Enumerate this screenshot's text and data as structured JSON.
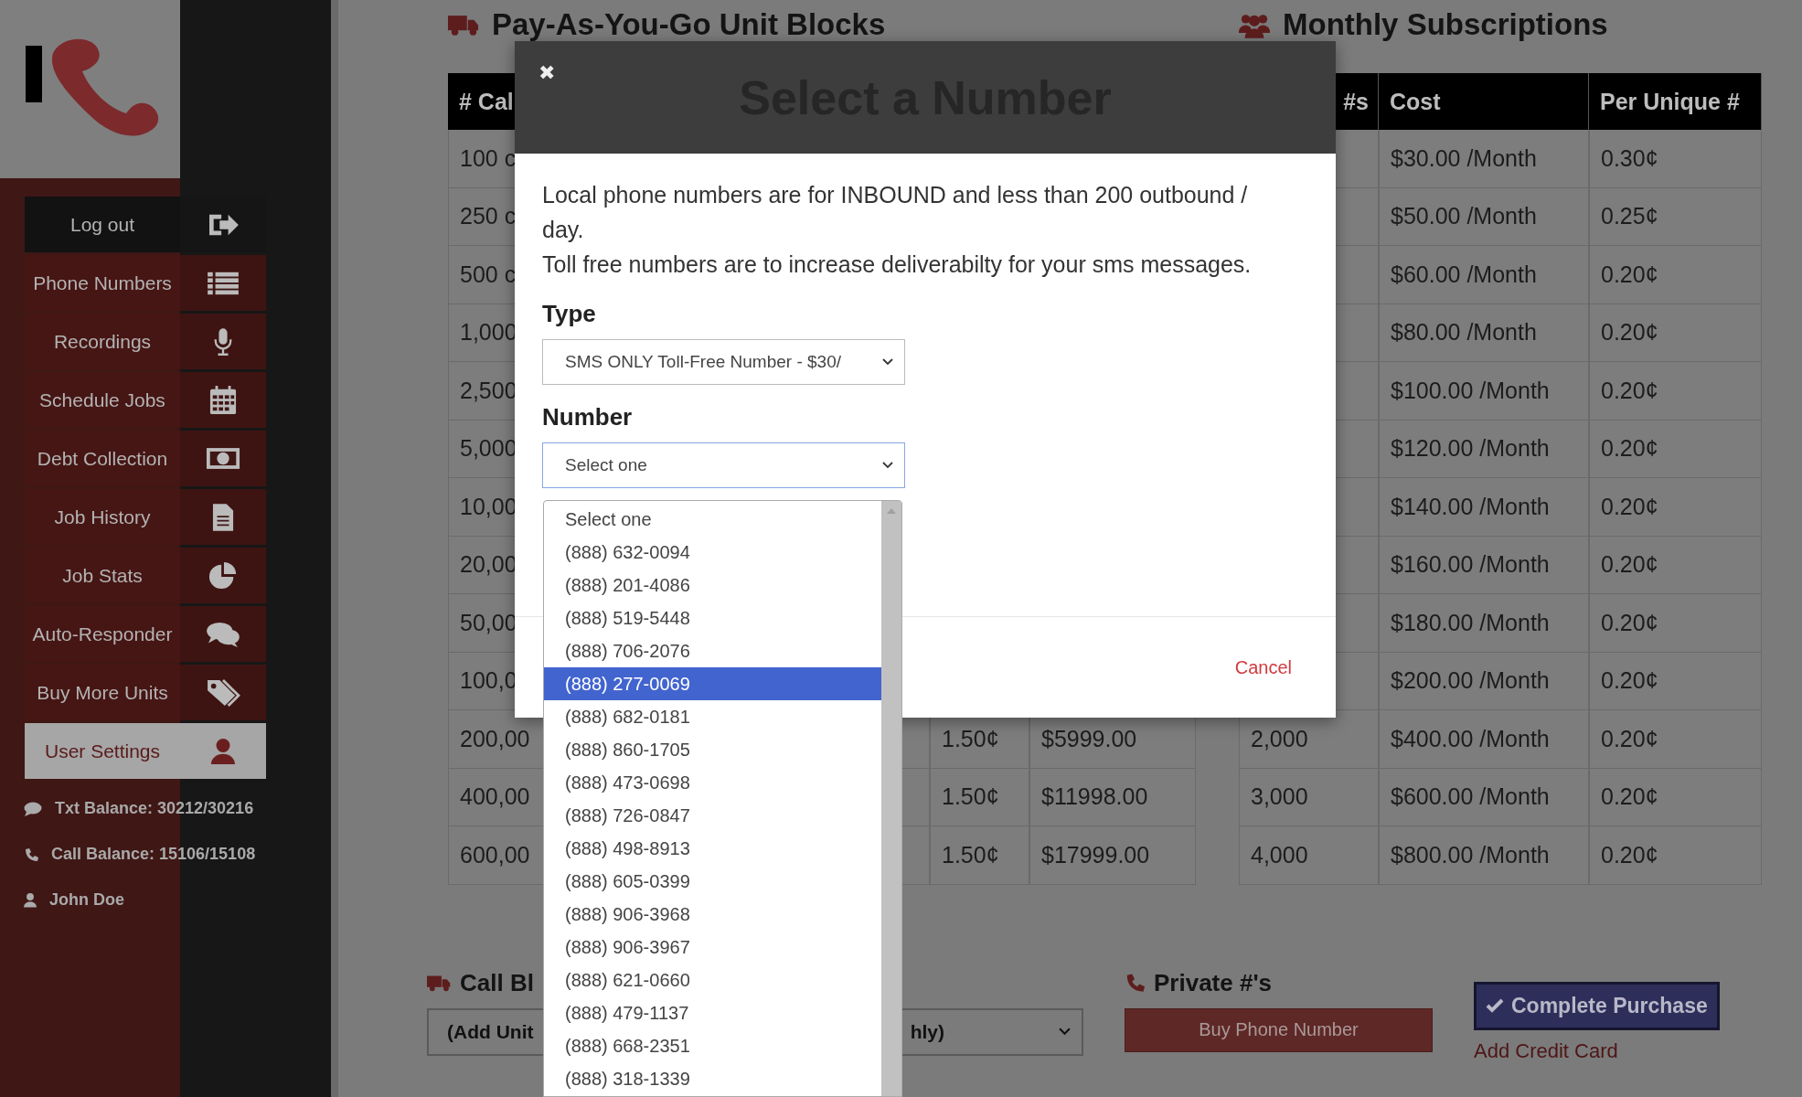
{
  "sidebar": {
    "logout": "Log out",
    "items": [
      {
        "label": "Phone Numbers",
        "selected": false
      },
      {
        "label": "Recordings",
        "selected": false
      },
      {
        "label": "Schedule Jobs",
        "selected": false
      },
      {
        "label": "Debt Collection",
        "selected": false
      },
      {
        "label": "Job History",
        "selected": false
      },
      {
        "label": "Job Stats",
        "selected": false
      },
      {
        "label": "Auto-Responder",
        "selected": false
      },
      {
        "label": "Buy More Units",
        "selected": false
      },
      {
        "label": "User Settings",
        "selected": true
      }
    ],
    "balances": [
      {
        "kind": "txt",
        "text": "Txt Balance: 30212/30216"
      },
      {
        "kind": "call",
        "text": "Call Balance: 15106/15108"
      },
      {
        "kind": "user",
        "text": "John Doe"
      }
    ]
  },
  "payg": {
    "title": "Pay-As-You-Go Unit Blocks",
    "columns": [
      "# Cal"
    ],
    "rows": [
      {
        "column_1": "100 c"
      },
      {
        "column_1": "250 c"
      },
      {
        "column_1": "500 c"
      },
      {
        "column_1": "1,000"
      },
      {
        "column_1": "2,500"
      },
      {
        "column_1": "5,000"
      },
      {
        "column_1": "10,00"
      },
      {
        "column_1": "20,00"
      },
      {
        "column_1": "50,00"
      },
      {
        "column_1": "100,0"
      },
      {
        "column_1": "200,00",
        "column_2": "1.50¢",
        "column_3": "$5999.00"
      },
      {
        "column_1": "400,00",
        "column_2": "1.50¢",
        "column_3": "$11998.00"
      },
      {
        "column_1": "600,00",
        "column_2": "1.50¢",
        "column_3": "$17999.00"
      }
    ]
  },
  "monthly": {
    "title": "Monthly Subscriptions",
    "columns": [
      "#s",
      "Cost",
      "Per Unique #"
    ],
    "rows": [
      {
        "cost": "$30.00 /Month",
        "per_unique": "0.30¢"
      },
      {
        "cost": "$50.00 /Month",
        "per_unique": "0.25¢"
      },
      {
        "cost": "$60.00 /Month",
        "per_unique": "0.20¢"
      },
      {
        "cost": "$80.00 /Month",
        "per_unique": "0.20¢"
      },
      {
        "cost": "$100.00 /Month",
        "per_unique": "0.20¢"
      },
      {
        "cost": "$120.00 /Month",
        "per_unique": "0.20¢"
      },
      {
        "cost": "$140.00 /Month",
        "per_unique": "0.20¢"
      },
      {
        "cost": "$160.00 /Month",
        "per_unique": "0.20¢"
      },
      {
        "cost": "$180.00 /Month",
        "per_unique": "0.20¢"
      },
      {
        "cost": "$200.00 /Month",
        "per_unique": "0.20¢"
      },
      {
        "column_1": "2,000",
        "cost": "$400.00 /Month",
        "per_unique": "0.20¢"
      },
      {
        "column_1": "3,000",
        "cost": "$600.00 /Month",
        "per_unique": "0.20¢"
      },
      {
        "column_1": "4,000",
        "cost": "$800.00 /Month",
        "per_unique": "0.20¢"
      }
    ]
  },
  "call_blocks": {
    "title": "Call Bl",
    "select_left": "(Add Unit",
    "select_right": "hly)"
  },
  "private": {
    "title": "Private #'s",
    "button": "Buy Phone Number"
  },
  "complete_purchase": "Complete Purchase",
  "add_credit_card": "Add Credit Card",
  "modal": {
    "title": "Select a Number",
    "close": "✖",
    "intro": [
      "Local phone numbers are for INBOUND and less than 200 outbound / day.",
      "Toll free numbers are to increase deliverabilty for your sms messages."
    ],
    "type_label": "Type",
    "type_value": "SMS ONLY Toll-Free Number - $30/",
    "number_label": "Number",
    "number_value": "Select one",
    "options": [
      {
        "label": "Select one",
        "selected": false
      },
      {
        "label": "(888) 632-0094",
        "selected": false
      },
      {
        "label": "(888) 201-4086",
        "selected": false
      },
      {
        "label": "(888) 519-5448",
        "selected": false
      },
      {
        "label": "(888) 706-2076",
        "selected": false
      },
      {
        "label": "(888) 277-0069",
        "selected": true
      },
      {
        "label": "(888) 682-0181",
        "selected": false
      },
      {
        "label": "(888) 860-1705",
        "selected": false
      },
      {
        "label": "(888) 473-0698",
        "selected": false
      },
      {
        "label": "(888) 726-0847",
        "selected": false
      },
      {
        "label": "(888) 498-8913",
        "selected": false
      },
      {
        "label": "(888) 605-0399",
        "selected": false
      },
      {
        "label": "(888) 906-3968",
        "selected": false
      },
      {
        "label": "(888) 906-3967",
        "selected": false
      },
      {
        "label": "(888) 621-0660",
        "selected": false
      },
      {
        "label": "(888) 479-1137",
        "selected": false
      },
      {
        "label": "(888) 668-2351",
        "selected": false
      },
      {
        "label": "(888) 318-1339",
        "selected": false
      }
    ],
    "cancel": "Cancel"
  }
}
